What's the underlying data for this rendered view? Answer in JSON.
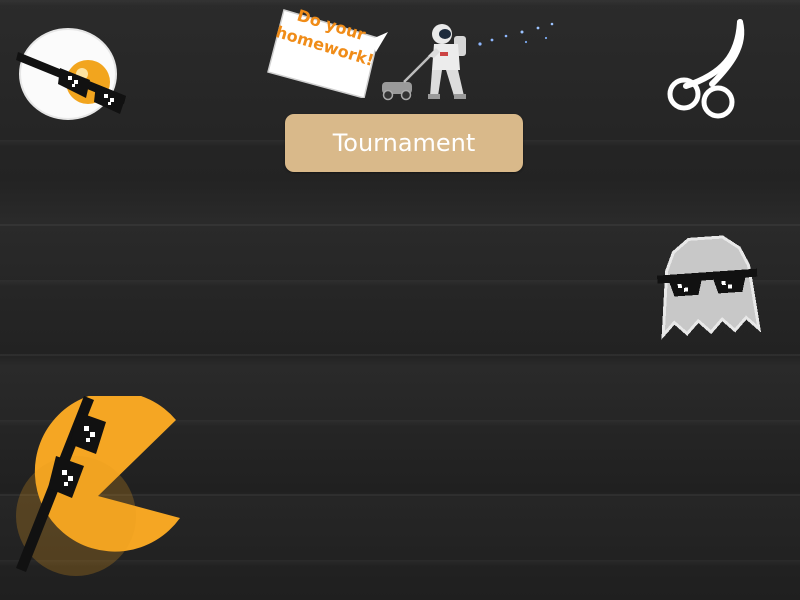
{
  "menu": {
    "tournament_label": "Tournament"
  },
  "speech_bubble": {
    "line1": "Do your",
    "line2": "homework!"
  },
  "icons": {
    "top_left": "fried-egg-with-sunglasses-icon",
    "top_center": "astronaut-mowing-lawn-icon",
    "top_right": "cherries-icon",
    "right": "ghost-with-sunglasses-icon",
    "bottom_left": "pacman-with-sunglasses-icon"
  },
  "colors": {
    "button_bg": "#d9b98a",
    "button_text": "#ffffff",
    "bubble_text": "#f08c18",
    "pacman": "#f5a623",
    "ghost": "#c8c8c8"
  }
}
